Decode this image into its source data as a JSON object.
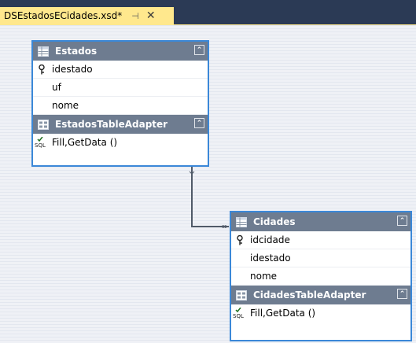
{
  "tab": {
    "title": "DSEstadosECidades.xsd*",
    "pin_glyph": "⊣",
    "close_glyph": "✕"
  },
  "tables": {
    "estados": {
      "name": "Estados",
      "columns": [
        "idestado",
        "uf",
        "nome"
      ],
      "key_column": "idestado",
      "adapter": {
        "name": "EstadosTableAdapter",
        "query": "Fill,GetData ()"
      }
    },
    "cidades": {
      "name": "Cidades",
      "columns": [
        "idcidade",
        "idestado",
        "nome"
      ],
      "key_column": "idcidade",
      "adapter": {
        "name": "CidadesTableAdapter",
        "query": "Fill,GetData ()"
      }
    }
  },
  "colors": {
    "tab_bg": "#2b3a55",
    "active_tab": "#ffe88d",
    "header": "#6e7c90",
    "selection_border": "#3b88d8"
  },
  "icons": {
    "table": "datatable-icon",
    "adapter": "tableadapter-icon",
    "key": "key-icon",
    "query": "sql-query-icon",
    "collapse": "collapse-chevron-icon"
  }
}
